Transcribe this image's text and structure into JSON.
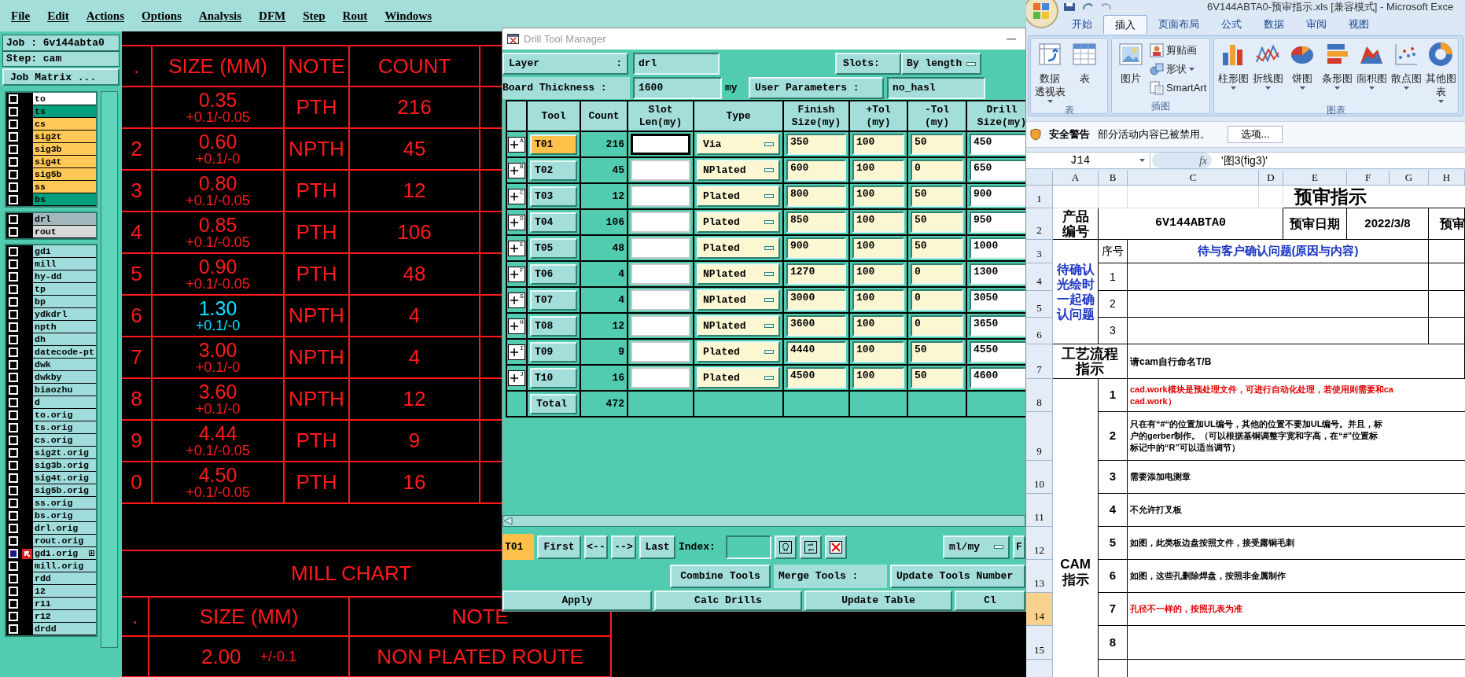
{
  "cam": {
    "menu": [
      "File",
      "Edit",
      "Actions",
      "Options",
      "Analysis",
      "DFM",
      "Step",
      "Rout",
      "Windows"
    ],
    "job_label": "Job : 6v144abta0",
    "step_label": "Step: cam",
    "job_matrix_button": "Job Matrix ...",
    "layer_groups": [
      {
        "layers": [
          {
            "name": "to",
            "color": "#ffffff",
            "selected": false
          },
          {
            "name": "ts",
            "color": "#00a07c",
            "selected": false
          },
          {
            "name": "cs",
            "color": "#ffc857",
            "selected": false
          },
          {
            "name": "sig2t",
            "color": "#ffc857",
            "selected": false
          },
          {
            "name": "sig3b",
            "color": "#ffc857",
            "selected": false
          },
          {
            "name": "sig4t",
            "color": "#ffc857",
            "selected": false
          },
          {
            "name": "sig5b",
            "color": "#ffc857",
            "selected": false
          },
          {
            "name": "ss",
            "color": "#ffc857",
            "selected": false
          },
          {
            "name": "bs",
            "color": "#00a07c",
            "selected": false
          }
        ]
      },
      {
        "layers": [
          {
            "name": "drl",
            "color": "#a3b8bc",
            "selected": false
          },
          {
            "name": "rout",
            "color": "#d9d9d9",
            "selected": false
          }
        ]
      },
      {
        "layers": [
          {
            "name": "gd1",
            "color": "#a0dcdc",
            "selected": false
          },
          {
            "name": "mill",
            "color": "#a0dcdc",
            "selected": false
          },
          {
            "name": "hy-dd",
            "color": "#a0dcdc",
            "selected": false
          },
          {
            "name": "tp",
            "color": "#a0dcdc",
            "selected": false
          },
          {
            "name": "bp",
            "color": "#a0dcdc",
            "selected": false
          },
          {
            "name": "ydkdrl",
            "color": "#a0dcdc",
            "selected": false
          },
          {
            "name": "npth",
            "color": "#a0dcdc",
            "selected": false
          },
          {
            "name": "dh",
            "color": "#a0dcdc",
            "selected": false
          },
          {
            "name": "datecode-pt",
            "color": "#a0dcdc",
            "selected": false
          },
          {
            "name": "dwk",
            "color": "#a0dcdc",
            "selected": false
          },
          {
            "name": "dwkby",
            "color": "#a0dcdc",
            "selected": false
          },
          {
            "name": "biaozhu",
            "color": "#a0dcdc",
            "selected": false
          },
          {
            "name": "d",
            "color": "#a0dcdc",
            "selected": false
          },
          {
            "name": "to.orig",
            "color": "#a0dcdc",
            "selected": false
          },
          {
            "name": "ts.orig",
            "color": "#a0dcdc",
            "selected": false
          },
          {
            "name": "cs.orig",
            "color": "#a0dcdc",
            "selected": false
          },
          {
            "name": "sig2t.orig",
            "color": "#a0dcdc",
            "selected": false
          },
          {
            "name": "sig3b.orig",
            "color": "#a0dcdc",
            "selected": false
          },
          {
            "name": "sig4t.orig",
            "color": "#a0dcdc",
            "selected": false
          },
          {
            "name": "sig5b.orig",
            "color": "#a0dcdc",
            "selected": false
          },
          {
            "name": "ss.orig",
            "color": "#a0dcdc",
            "selected": false
          },
          {
            "name": "bs.orig",
            "color": "#a0dcdc",
            "selected": false
          },
          {
            "name": "drl.orig",
            "color": "#a0dcdc",
            "selected": false
          },
          {
            "name": "rout.orig",
            "color": "#a0dcdc",
            "selected": false
          },
          {
            "name": "gd1.orig",
            "color": "#a0dcdc",
            "selected": true
          },
          {
            "name": "mill.orig",
            "color": "#a0dcdc",
            "selected": false
          },
          {
            "name": "rdd",
            "color": "#a0dcdc",
            "selected": false
          },
          {
            "name": "12",
            "color": "#a0dcdc",
            "selected": false
          },
          {
            "name": "r11",
            "color": "#a0dcdc",
            "selected": false
          },
          {
            "name": "r12",
            "color": "#a0dcdc",
            "selected": false
          },
          {
            "name": "drdd",
            "color": "#a0dcdc",
            "selected": false
          }
        ]
      }
    ],
    "drill_chart": {
      "columns": [
        ".",
        "SIZE (MM)",
        "NOTE",
        "COUNT"
      ],
      "rows": [
        {
          "size": "0.35",
          "tolerance": "+0.1/-0.05",
          "note": "PTH",
          "count": "216",
          "highlighted": false
        },
        {
          "column_1": "2",
          "size": "0.60",
          "tolerance": "+0.1/-0",
          "note": "NPTH",
          "count": "45",
          "highlighted": false
        },
        {
          "column_1": "3",
          "size": "0.80",
          "tolerance": "+0.1/-0.05",
          "note": "PTH",
          "count": "12",
          "highlighted": false
        },
        {
          "column_1": "4",
          "size": "0.85",
          "tolerance": "+0.1/-0.05",
          "note": "PTH",
          "count": "106",
          "highlighted": false
        },
        {
          "column_1": "5",
          "size": "0.90",
          "tolerance": "+0.1/-0.05",
          "note": "PTH",
          "count": "48",
          "highlighted": false
        },
        {
          "column_1": "6",
          "size": "1.30",
          "tolerance": "+0.1/-0",
          "note": "NPTH",
          "count": "4",
          "highlighted": true
        },
        {
          "column_1": "7",
          "size": "3.00",
          "tolerance": "+0.1/-0",
          "note": "NPTH",
          "count": "4",
          "highlighted": false
        },
        {
          "column_1": "8",
          "size": "3.60",
          "tolerance": "+0.1/-0",
          "note": "NPTH",
          "count": "12",
          "highlighted": false
        },
        {
          "column_1": "9",
          "size": "4.44",
          "tolerance": "+0.1/-0.05",
          "note": "PTH",
          "count": "9",
          "highlighted": false
        },
        {
          "column_1": "0",
          "size": "4.50",
          "tolerance": "+0.1/-0.05",
          "note": "PTH",
          "count": "16",
          "highlighted": false
        }
      ]
    },
    "mill_chart": {
      "title": "MILL CHART",
      "columns": [
        ".",
        "SIZE (MM)",
        "NOTE"
      ],
      "rows": [
        {
          "size": "2.00",
          "tolerance": "+/-0.1",
          "note": "NON PLATED ROUTE"
        }
      ]
    }
  },
  "drill_tool_manager": {
    "title": "Drill Tool Manager",
    "layer_label": "Layer",
    "layer_colon": ":",
    "layer_value": "drl",
    "slots_label": "Slots:",
    "slots_value": "By length",
    "thickness_label": "Board Thickness :",
    "thickness_value": "1600",
    "thickness_unit": "my",
    "user_params_button": "User Parameters :",
    "user_params_value": "no_hasl",
    "columns": [
      [
        "Tool"
      ],
      [
        "Count"
      ],
      [
        "Slot",
        "Len(my)"
      ],
      [
        "Type"
      ],
      [
        "Finish",
        "Size(my)"
      ],
      [
        "+Tol",
        "(my)"
      ],
      [
        "-Tol",
        "(my)"
      ],
      [
        "Drill",
        "Size(my)"
      ]
    ],
    "rows": [
      {
        "marker": "A",
        "tool": "T01",
        "count": "216",
        "type": "Via",
        "finish": "350",
        "plus_tol": "100",
        "minus_tol": "50",
        "drill": "450",
        "selected": true,
        "focused": true
      },
      {
        "marker": "B",
        "tool": "T02",
        "count": "45",
        "type": "NPlated",
        "finish": "600",
        "plus_tol": "100",
        "minus_tol": "0",
        "drill": "650",
        "selected": false,
        "focused": false
      },
      {
        "marker": "C",
        "tool": "T03",
        "count": "12",
        "type": "Plated",
        "finish": "800",
        "plus_tol": "100",
        "minus_tol": "50",
        "drill": "900",
        "selected": false,
        "focused": false
      },
      {
        "marker": "D",
        "tool": "T04",
        "count": "106",
        "type": "Plated",
        "finish": "850",
        "plus_tol": "100",
        "minus_tol": "50",
        "drill": "950",
        "selected": false,
        "focused": false
      },
      {
        "marker": "E",
        "tool": "T05",
        "count": "48",
        "type": "Plated",
        "finish": "900",
        "plus_tol": "100",
        "minus_tol": "50",
        "drill": "1000",
        "selected": false,
        "focused": false
      },
      {
        "marker": "F",
        "tool": "T06",
        "count": "4",
        "type": "NPlated",
        "finish": "1270",
        "plus_tol": "100",
        "minus_tol": "0",
        "drill": "1300",
        "selected": false,
        "focused": false
      },
      {
        "marker": "G",
        "tool": "T07",
        "count": "4",
        "type": "NPlated",
        "finish": "3000",
        "plus_tol": "100",
        "minus_tol": "0",
        "drill": "3050",
        "selected": false,
        "focused": false
      },
      {
        "marker": "H",
        "tool": "T08",
        "count": "12",
        "type": "NPlated",
        "finish": "3600",
        "plus_tol": "100",
        "minus_tol": "0",
        "drill": "3650",
        "selected": false,
        "focused": false
      },
      {
        "marker": "I",
        "tool": "T09",
        "count": "9",
        "type": "Plated",
        "finish": "4440",
        "plus_tol": "100",
        "minus_tol": "50",
        "drill": "4550",
        "selected": false,
        "focused": false
      },
      {
        "marker": "J",
        "tool": "T10",
        "count": "16",
        "type": "Plated",
        "finish": "4500",
        "plus_tol": "100",
        "minus_tol": "50",
        "drill": "4600",
        "selected": false,
        "focused": false
      }
    ],
    "total_label": "Total",
    "total_count": "472",
    "nav": {
      "current_tool": "T01",
      "buttons": [
        "First",
        "<--",
        "-->",
        "Last"
      ],
      "index_label": "Index:",
      "units": "ml/my",
      "cut_button": "F"
    },
    "actions": {
      "combine": "Combine Tools",
      "merge_label": "Merge Tools :",
      "update_numbers": "Update Tools Number"
    },
    "bottom_buttons": [
      "Apply",
      "Calc Drills",
      "Update Table",
      "Cl"
    ]
  },
  "excel": {
    "title": "6V144ABTA0-预审指示.xls  [兼容模式] - Microsoft Exce",
    "tabs": [
      {
        "label": "开始",
        "selected": false
      },
      {
        "label": "插入",
        "selected": true
      },
      {
        "label": "页面布局",
        "selected": false
      },
      {
        "label": "公式",
        "selected": false
      },
      {
        "label": "数据",
        "selected": false
      },
      {
        "label": "审阅",
        "selected": false
      },
      {
        "label": "视图",
        "selected": false
      }
    ],
    "ribbon_groups": [
      {
        "label": "表",
        "items": [
          {
            "kind": "pivot",
            "lines": [
              "数据",
              "透视表"
            ],
            "dropdown": true
          },
          {
            "kind": "table",
            "lines": [
              "表"
            ],
            "dropdown": false
          }
        ]
      },
      {
        "label": "插图",
        "items": [
          {
            "kind": "picture",
            "lines": [
              "图片"
            ],
            "dropdown": false
          },
          {
            "kind": "clipart",
            "lines": [
              "剪贴画"
            ],
            "dropdown": false
          },
          {
            "kind": "shapes",
            "lines": [
              "形状"
            ],
            "dropdown": true
          },
          {
            "kind": "smartart",
            "lines": [
              "SmartArt"
            ],
            "dropdown": false
          }
        ]
      },
      {
        "label": "图表",
        "items": [
          {
            "kind": "column",
            "lines": [
              "柱形图"
            ],
            "dropdown": true
          },
          {
            "kind": "line",
            "lines": [
              "折线图"
            ],
            "dropdown": true
          },
          {
            "kind": "pie",
            "lines": [
              "饼图"
            ],
            "dropdown": true
          },
          {
            "kind": "bar",
            "lines": [
              "条形图"
            ],
            "dropdown": true
          },
          {
            "kind": "area",
            "lines": [
              "面积图"
            ],
            "dropdown": true
          },
          {
            "kind": "scatter",
            "lines": [
              "散点图"
            ],
            "dropdown": true
          },
          {
            "kind": "other",
            "lines": [
              "其他图表"
            ],
            "dropdown": true
          }
        ]
      }
    ],
    "security": {
      "title": "安全警告",
      "message": "部分活动内容已被禁用。",
      "button": "选项..."
    },
    "name_box": "J14",
    "function_button": "fx",
    "formula": "'图3(fig3)'",
    "columns": [
      "A",
      "B",
      "C",
      "D",
      "E",
      "F",
      "G",
      "H"
    ],
    "row_numbers": [
      {
        "label": "1",
        "selected": false
      },
      {
        "label": "2",
        "selected": false
      },
      {
        "label": "3",
        "selected": false
      },
      {
        "label": "4",
        "selected": false
      },
      {
        "label": "5",
        "selected": false
      },
      {
        "label": "6",
        "selected": false
      },
      {
        "label": "7",
        "selected": false
      },
      {
        "label": "8",
        "selected": false
      },
      {
        "label": "9",
        "selected": false
      },
      {
        "label": "10",
        "selected": false
      },
      {
        "label": "11",
        "selected": false
      },
      {
        "label": "12",
        "selected": false
      },
      {
        "label": "13",
        "selected": false
      },
      {
        "label": "14",
        "selected": true
      },
      {
        "label": "15",
        "selected": false
      }
    ],
    "sheet": {
      "title": "预审指示",
      "product_label": "产品编号",
      "product_value": "6V144ABTA0",
      "date_label": "预审日期",
      "date_value": "2022/3/8",
      "column_h_label": "预审",
      "confirm_label": "待确认光绘时一起确认问题",
      "seq_header": "序号",
      "question_header": "待与客户确认问题(原因与内容)",
      "question_numbers": [
        "1",
        "2",
        "3"
      ],
      "process_label": "工艺流程指示",
      "process_value": "请cam自行命名T/B",
      "cam_label": "CAM指示",
      "instructions": [
        {
          "number": "1",
          "color": "#e00000",
          "lines": [
            "cad.work模块是预处理文件，可进行自动化处理，若使用则需要和ca",
            "cad.work）"
          ]
        },
        {
          "number": "2",
          "color": "#000000",
          "lines": [
            "只在有“#“的位置加UL编号，其他的位置不要加UL编号。并且，标",
            "户的gerber制作。（可以根据基铜调整字宽和字高，在“#”位置标",
            "标记中的“R”可以适当调节）"
          ]
        },
        {
          "number": "3",
          "color": "#000000",
          "lines": [
            "需要添加电测章"
          ]
        },
        {
          "number": "4",
          "color": "#000000",
          "lines": [
            "不允许打叉板"
          ]
        },
        {
          "number": "5",
          "color": "#000000",
          "lines": [
            "如图，此类板边盘按照文件，接受露铜毛刺"
          ]
        },
        {
          "number": "6",
          "color": "#000000",
          "lines": [
            "如图，这些孔删除焊盘，按照非金属制作"
          ]
        },
        {
          "number": "7",
          "color": "#e00000",
          "lines": [
            "孔径不一样的，按照孔表为准"
          ]
        },
        {
          "number": "8"
        }
      ]
    }
  }
}
